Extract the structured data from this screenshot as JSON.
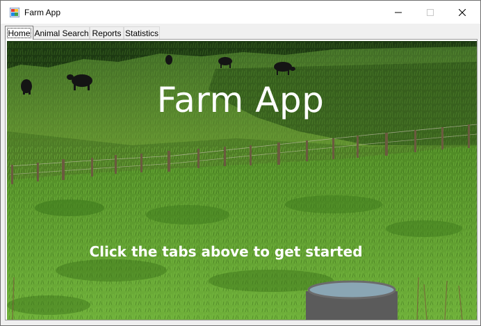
{
  "window": {
    "title": "Farm App",
    "icon": "farm-app-icon",
    "controls": [
      "minimize-icon",
      "maximize-icon",
      "close-icon"
    ]
  },
  "tabs": [
    {
      "label": "Home",
      "selected": true
    },
    {
      "label": "Animal Search",
      "selected": false
    },
    {
      "label": "Reports",
      "selected": false
    },
    {
      "label": "Statistics",
      "selected": false
    }
  ],
  "home": {
    "headline": "Farm App",
    "instruction": "Click the tabs above to get started",
    "background": "pasture-photo"
  },
  "colors": {
    "text_on_photo": "#ffffff",
    "grass": "#5a8f2a",
    "shadow": "#2f4f17"
  }
}
